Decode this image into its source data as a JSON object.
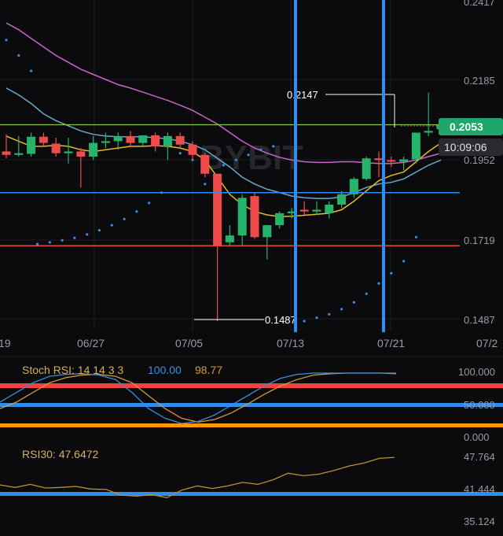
{
  "colors": {
    "background": "#0b0b0e",
    "grid": "#1c1c22",
    "up": "#26b36b",
    "down": "#ef4b4b",
    "ma_yellow": "#e8b923",
    "ma_blue": "#6aa9c9",
    "ma_pink": "#c667c6",
    "sar_dots": "#3b8de0",
    "axis_text": "#9a9aa2",
    "vline": "#2f8cf0",
    "hline_blue": "#2f8cf0",
    "hline_red": "#e94545",
    "hline_green": "#8bc34a",
    "price_tag": "#1fa66a",
    "countdown_bg": "#2a2a30",
    "stoch_k": "#3b8de0",
    "stoch_d": "#d49a3a",
    "stoch_label": "#d4b25a",
    "rsi_line": "#b8932e",
    "rsi_label": "#d4b25a",
    "orange_line": "#ff9800",
    "red_band": "#f04040",
    "blue_band": "#2f8cf0"
  },
  "watermark": "BYBIT",
  "price_axis": {
    "labels": [
      "0.2417",
      "0.2185",
      "0.1952",
      "0.1719",
      "0.1487"
    ],
    "values": [
      0.2417,
      0.2185,
      0.1952,
      0.1719,
      0.1487
    ]
  },
  "date_axis": {
    "labels": [
      "19",
      "06/27",
      "07/05",
      "07/13",
      "07/21",
      "07/2"
    ]
  },
  "price_tag": "0.2053",
  "countdown": "10:09:06",
  "high_marker": "0.2147",
  "low_marker": "0.1487",
  "stoch_rsi": {
    "label": "Stoch RSI: 14 14 3 3",
    "k_value": "100.00",
    "d_value": "98.77",
    "axis_labels": [
      "100.000",
      "50.000",
      "0.000"
    ]
  },
  "rsi": {
    "label": "RSI30: 47.6472",
    "axis_labels": [
      "47.764",
      "41.444",
      "35.124"
    ]
  },
  "chart_data": {
    "type": "candlestick",
    "price_range": [
      0.145,
      0.2417
    ],
    "candles": [
      {
        "o": 0.1975,
        "h": 0.2025,
        "l": 0.1955,
        "c": 0.1965
      },
      {
        "o": 0.1965,
        "h": 0.202,
        "l": 0.196,
        "c": 0.197
      },
      {
        "o": 0.1968,
        "h": 0.203,
        "l": 0.196,
        "c": 0.2018
      },
      {
        "o": 0.2018,
        "h": 0.203,
        "l": 0.199,
        "c": 0.2
      },
      {
        "o": 0.1998,
        "h": 0.2015,
        "l": 0.196,
        "c": 0.197
      },
      {
        "o": 0.197,
        "h": 0.2015,
        "l": 0.194,
        "c": 0.1975
      },
      {
        "o": 0.1975,
        "h": 0.1985,
        "l": 0.187,
        "c": 0.196
      },
      {
        "o": 0.196,
        "h": 0.202,
        "l": 0.195,
        "c": 0.2
      },
      {
        "o": 0.2,
        "h": 0.203,
        "l": 0.1985,
        "c": 0.2005
      },
      {
        "o": 0.2005,
        "h": 0.203,
        "l": 0.198,
        "c": 0.202
      },
      {
        "o": 0.202,
        "h": 0.2035,
        "l": 0.199,
        "c": 0.2
      },
      {
        "o": 0.2,
        "h": 0.202,
        "l": 0.199,
        "c": 0.2022
      },
      {
        "o": 0.2022,
        "h": 0.203,
        "l": 0.1975,
        "c": 0.199
      },
      {
        "o": 0.199,
        "h": 0.203,
        "l": 0.195,
        "c": 0.202
      },
      {
        "o": 0.202,
        "h": 0.203,
        "l": 0.1985,
        "c": 0.1995
      },
      {
        "o": 0.1995,
        "h": 0.2005,
        "l": 0.195,
        "c": 0.1965
      },
      {
        "o": 0.1965,
        "h": 0.197,
        "l": 0.19,
        "c": 0.191
      },
      {
        "o": 0.191,
        "h": 0.188,
        "l": 0.148,
        "c": 0.17
      },
      {
        "o": 0.171,
        "h": 0.176,
        "l": 0.17,
        "c": 0.173
      },
      {
        "o": 0.173,
        "h": 0.185,
        "l": 0.17,
        "c": 0.184
      },
      {
        "o": 0.1845,
        "h": 0.1855,
        "l": 0.172,
        "c": 0.1725
      },
      {
        "o": 0.1725,
        "h": 0.176,
        "l": 0.166,
        "c": 0.176
      },
      {
        "o": 0.176,
        "h": 0.18,
        "l": 0.175,
        "c": 0.1795
      },
      {
        "o": 0.1795,
        "h": 0.181,
        "l": 0.178,
        "c": 0.18
      },
      {
        "o": 0.1805,
        "h": 0.183,
        "l": 0.179,
        "c": 0.18
      },
      {
        "o": 0.18,
        "h": 0.183,
        "l": 0.179,
        "c": 0.1805
      },
      {
        "o": 0.1795,
        "h": 0.183,
        "l": 0.178,
        "c": 0.182
      },
      {
        "o": 0.182,
        "h": 0.186,
        "l": 0.181,
        "c": 0.185
      },
      {
        "o": 0.185,
        "h": 0.19,
        "l": 0.184,
        "c": 0.1895
      },
      {
        "o": 0.1895,
        "h": 0.196,
        "l": 0.189,
        "c": 0.1955
      },
      {
        "o": 0.1955,
        "h": 0.1975,
        "l": 0.19,
        "c": 0.195
      },
      {
        "o": 0.195,
        "h": 0.196,
        "l": 0.193,
        "c": 0.1945
      },
      {
        "o": 0.1945,
        "h": 0.196,
        "l": 0.192,
        "c": 0.1952
      },
      {
        "o": 0.1952,
        "h": 0.203,
        "l": 0.194,
        "c": 0.203
      },
      {
        "o": 0.203,
        "h": 0.2147,
        "l": 0.202,
        "c": 0.2035
      },
      {
        "o": 0.204,
        "h": 0.2065,
        "l": 0.203,
        "c": 0.2053
      }
    ],
    "ma_yellow": [
      0.202,
      0.2005,
      0.199,
      0.199,
      0.1993,
      0.199,
      0.198,
      0.1975,
      0.198,
      0.1985,
      0.199,
      0.199,
      0.1992,
      0.199,
      0.1985,
      0.1975,
      0.195,
      0.19,
      0.185,
      0.182,
      0.18,
      0.179,
      0.1785,
      0.1786,
      0.1789,
      0.1792,
      0.1795,
      0.1805,
      0.183,
      0.186,
      0.189,
      0.1905,
      0.1915,
      0.1945,
      0.1975,
      0.2
    ],
    "ma_blue": [
      0.216,
      0.214,
      0.2115,
      0.2085,
      0.2065,
      0.205,
      0.2035,
      0.2025,
      0.202,
      0.2018,
      0.2018,
      0.2018,
      0.2015,
      0.2012,
      0.2005,
      0.1995,
      0.198,
      0.1955,
      0.193,
      0.19,
      0.188,
      0.1865,
      0.1855,
      0.1845,
      0.184,
      0.1838,
      0.1838,
      0.1842,
      0.1855,
      0.187,
      0.188,
      0.1885,
      0.1895,
      0.1915,
      0.1935,
      0.195
    ],
    "ma_pink": [
      0.235,
      0.233,
      0.2305,
      0.228,
      0.2255,
      0.2235,
      0.2215,
      0.22,
      0.2185,
      0.217,
      0.216,
      0.2148,
      0.2136,
      0.2124,
      0.211,
      0.2095,
      0.2075,
      0.2055,
      0.203,
      0.2005,
      0.1985,
      0.197,
      0.1958,
      0.195,
      0.1945,
      0.1943,
      0.1943,
      0.1945,
      0.1945,
      0.1942,
      0.194,
      0.194,
      0.1943,
      0.195,
      0.196,
      0.197
    ],
    "sar": [
      {
        "i": 0,
        "v": 0.23
      },
      {
        "i": 1,
        "v": 0.2255
      },
      {
        "i": 2,
        "v": 0.221
      },
      {
        "i": 13,
        "v": 0.199
      },
      {
        "i": 14,
        "v": 0.197
      },
      {
        "i": 15,
        "v": 0.195
      },
      {
        "i": 2.5,
        "v": 0.1705
      },
      {
        "i": 3.5,
        "v": 0.171
      },
      {
        "i": 4.5,
        "v": 0.1716
      },
      {
        "i": 5.5,
        "v": 0.1723
      },
      {
        "i": 6.5,
        "v": 0.1733
      },
      {
        "i": 7.5,
        "v": 0.1745
      },
      {
        "i": 8.5,
        "v": 0.176
      },
      {
        "i": 9.5,
        "v": 0.1778
      },
      {
        "i": 10.5,
        "v": 0.18
      },
      {
        "i": 11.5,
        "v": 0.1825
      },
      {
        "i": 12.5,
        "v": 0.1855
      },
      {
        "i": 16,
        "v": 0.188
      },
      {
        "i": 24,
        "v": 0.148
      },
      {
        "i": 25,
        "v": 0.149
      },
      {
        "i": 26,
        "v": 0.15
      },
      {
        "i": 27,
        "v": 0.1515
      },
      {
        "i": 28,
        "v": 0.1535
      },
      {
        "i": 29,
        "v": 0.156
      },
      {
        "i": 30,
        "v": 0.159
      },
      {
        "i": 31,
        "v": 0.162
      },
      {
        "i": 32,
        "v": 0.1655
      },
      {
        "i": 33,
        "v": 0.1725
      },
      {
        "i": 17.5,
        "v": 0.1935
      },
      {
        "i": 18.5,
        "v": 0.195
      },
      {
        "i": 19.5,
        "v": 0.1965
      },
      {
        "i": 20.5,
        "v": 0.198
      },
      {
        "i": 21.5,
        "v": 0.199
      }
    ],
    "levels": {
      "green": 0.2053,
      "blue": 0.1855,
      "red": 0.17
    },
    "vlines_candle_index": [
      23.2,
      30.0
    ],
    "stoch_k": [
      55,
      70,
      85,
      95,
      98,
      99,
      97,
      90,
      70,
      45,
      30,
      22,
      25,
      35,
      50,
      65,
      80,
      92,
      98,
      100,
      100,
      100,
      100,
      100,
      100
    ],
    "stoch_d": [
      45,
      55,
      70,
      85,
      93,
      97,
      98,
      95,
      85,
      65,
      45,
      30,
      24,
      28,
      38,
      52,
      67,
      80,
      90,
      97,
      99,
      100,
      100,
      100,
      99
    ],
    "rsi": [
      42.2,
      41.7,
      42.3,
      41.6,
      41.7,
      41.9,
      41.4,
      41.3,
      40.2,
      40.0,
      40.3,
      39.7,
      41.2,
      42.0,
      41.5,
      42.0,
      42.7,
      42.3,
      43.2,
      44.5,
      44.0,
      44.3,
      45.0,
      45.9,
      46.5,
      47.4,
      47.6
    ]
  }
}
